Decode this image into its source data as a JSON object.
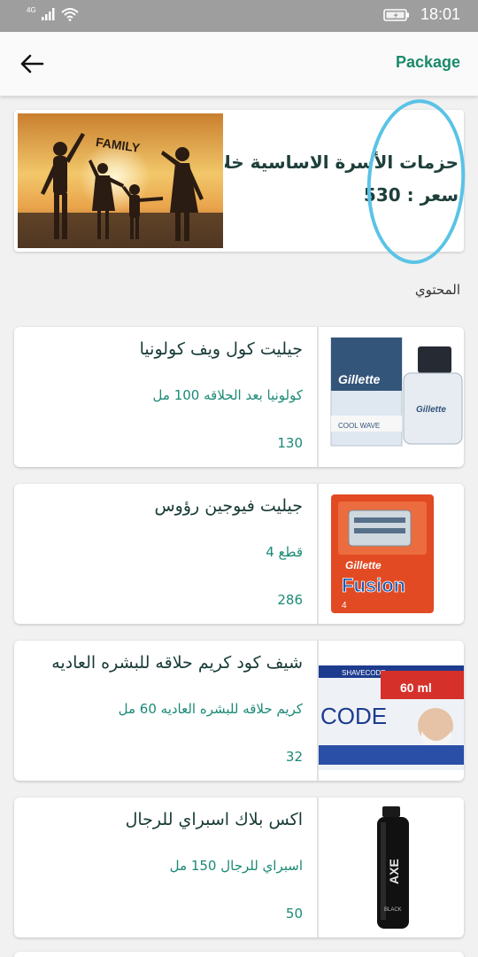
{
  "status_bar": {
    "network": "4G",
    "time": "18:01"
  },
  "app_bar": {
    "title": "Package"
  },
  "package": {
    "name": "حزمات الأسرة الاساسية خلال شهر",
    "price": "سعر : 530",
    "image_text": "FAMILY"
  },
  "section_label": "المحتوي",
  "items": [
    {
      "name": "جيليت كول ويف كولونيا",
      "desc": "كولونيا بعد الحلاقه 100 مل",
      "price": "130",
      "img_brand": "Gillette",
      "img_sub": "COOL WAVE"
    },
    {
      "name": "جيليت فيوجين رؤوس",
      "desc": "قطع 4",
      "price": "286",
      "img_brand": "Gillette",
      "img_sub": "Fusion",
      "img_count": "4"
    },
    {
      "name": "شيف كود كريم حلاقه للبشره العاديه",
      "desc": "كريم حلاقه للبشره العاديه 60 مل",
      "price": "32",
      "img_brand": "CODE",
      "img_sub": "60 ml",
      "img_top": "SHAVECODE"
    },
    {
      "name": "اكس بلاك اسبراي للرجال",
      "desc": "اسبراي للرجال 150 مل",
      "price": "50",
      "img_brand": "AXE",
      "img_sub": "BLACK"
    }
  ]
}
